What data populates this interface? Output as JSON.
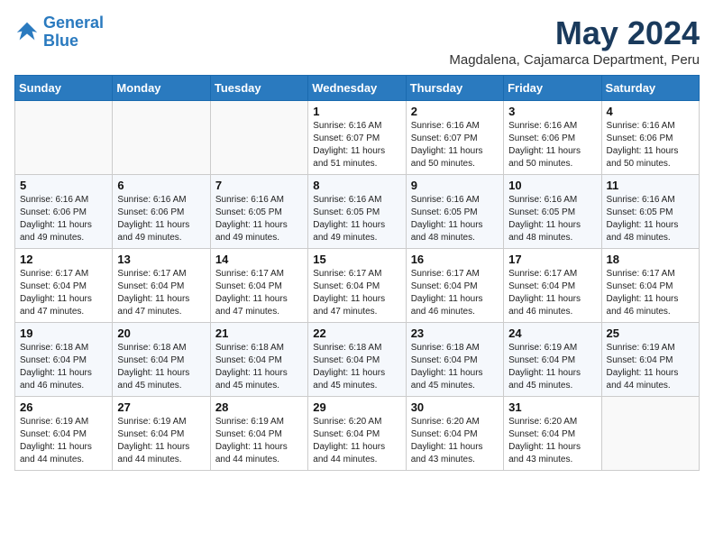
{
  "logo": {
    "line1": "General",
    "line2": "Blue"
  },
  "title": "May 2024",
  "location": "Magdalena, Cajamarca Department, Peru",
  "days_of_week": [
    "Sunday",
    "Monday",
    "Tuesday",
    "Wednesday",
    "Thursday",
    "Friday",
    "Saturday"
  ],
  "weeks": [
    [
      {
        "day": "",
        "info": ""
      },
      {
        "day": "",
        "info": ""
      },
      {
        "day": "",
        "info": ""
      },
      {
        "day": "1",
        "info": "Sunrise: 6:16 AM\nSunset: 6:07 PM\nDaylight: 11 hours\nand 51 minutes."
      },
      {
        "day": "2",
        "info": "Sunrise: 6:16 AM\nSunset: 6:07 PM\nDaylight: 11 hours\nand 50 minutes."
      },
      {
        "day": "3",
        "info": "Sunrise: 6:16 AM\nSunset: 6:06 PM\nDaylight: 11 hours\nand 50 minutes."
      },
      {
        "day": "4",
        "info": "Sunrise: 6:16 AM\nSunset: 6:06 PM\nDaylight: 11 hours\nand 50 minutes."
      }
    ],
    [
      {
        "day": "5",
        "info": "Sunrise: 6:16 AM\nSunset: 6:06 PM\nDaylight: 11 hours\nand 49 minutes."
      },
      {
        "day": "6",
        "info": "Sunrise: 6:16 AM\nSunset: 6:06 PM\nDaylight: 11 hours\nand 49 minutes."
      },
      {
        "day": "7",
        "info": "Sunrise: 6:16 AM\nSunset: 6:05 PM\nDaylight: 11 hours\nand 49 minutes."
      },
      {
        "day": "8",
        "info": "Sunrise: 6:16 AM\nSunset: 6:05 PM\nDaylight: 11 hours\nand 49 minutes."
      },
      {
        "day": "9",
        "info": "Sunrise: 6:16 AM\nSunset: 6:05 PM\nDaylight: 11 hours\nand 48 minutes."
      },
      {
        "day": "10",
        "info": "Sunrise: 6:16 AM\nSunset: 6:05 PM\nDaylight: 11 hours\nand 48 minutes."
      },
      {
        "day": "11",
        "info": "Sunrise: 6:16 AM\nSunset: 6:05 PM\nDaylight: 11 hours\nand 48 minutes."
      }
    ],
    [
      {
        "day": "12",
        "info": "Sunrise: 6:17 AM\nSunset: 6:04 PM\nDaylight: 11 hours\nand 47 minutes."
      },
      {
        "day": "13",
        "info": "Sunrise: 6:17 AM\nSunset: 6:04 PM\nDaylight: 11 hours\nand 47 minutes."
      },
      {
        "day": "14",
        "info": "Sunrise: 6:17 AM\nSunset: 6:04 PM\nDaylight: 11 hours\nand 47 minutes."
      },
      {
        "day": "15",
        "info": "Sunrise: 6:17 AM\nSunset: 6:04 PM\nDaylight: 11 hours\nand 47 minutes."
      },
      {
        "day": "16",
        "info": "Sunrise: 6:17 AM\nSunset: 6:04 PM\nDaylight: 11 hours\nand 46 minutes."
      },
      {
        "day": "17",
        "info": "Sunrise: 6:17 AM\nSunset: 6:04 PM\nDaylight: 11 hours\nand 46 minutes."
      },
      {
        "day": "18",
        "info": "Sunrise: 6:17 AM\nSunset: 6:04 PM\nDaylight: 11 hours\nand 46 minutes."
      }
    ],
    [
      {
        "day": "19",
        "info": "Sunrise: 6:18 AM\nSunset: 6:04 PM\nDaylight: 11 hours\nand 46 minutes."
      },
      {
        "day": "20",
        "info": "Sunrise: 6:18 AM\nSunset: 6:04 PM\nDaylight: 11 hours\nand 45 minutes."
      },
      {
        "day": "21",
        "info": "Sunrise: 6:18 AM\nSunset: 6:04 PM\nDaylight: 11 hours\nand 45 minutes."
      },
      {
        "day": "22",
        "info": "Sunrise: 6:18 AM\nSunset: 6:04 PM\nDaylight: 11 hours\nand 45 minutes."
      },
      {
        "day": "23",
        "info": "Sunrise: 6:18 AM\nSunset: 6:04 PM\nDaylight: 11 hours\nand 45 minutes."
      },
      {
        "day": "24",
        "info": "Sunrise: 6:19 AM\nSunset: 6:04 PM\nDaylight: 11 hours\nand 45 minutes."
      },
      {
        "day": "25",
        "info": "Sunrise: 6:19 AM\nSunset: 6:04 PM\nDaylight: 11 hours\nand 44 minutes."
      }
    ],
    [
      {
        "day": "26",
        "info": "Sunrise: 6:19 AM\nSunset: 6:04 PM\nDaylight: 11 hours\nand 44 minutes."
      },
      {
        "day": "27",
        "info": "Sunrise: 6:19 AM\nSunset: 6:04 PM\nDaylight: 11 hours\nand 44 minutes."
      },
      {
        "day": "28",
        "info": "Sunrise: 6:19 AM\nSunset: 6:04 PM\nDaylight: 11 hours\nand 44 minutes."
      },
      {
        "day": "29",
        "info": "Sunrise: 6:20 AM\nSunset: 6:04 PM\nDaylight: 11 hours\nand 44 minutes."
      },
      {
        "day": "30",
        "info": "Sunrise: 6:20 AM\nSunset: 6:04 PM\nDaylight: 11 hours\nand 43 minutes."
      },
      {
        "day": "31",
        "info": "Sunrise: 6:20 AM\nSunset: 6:04 PM\nDaylight: 11 hours\nand 43 minutes."
      },
      {
        "day": "",
        "info": ""
      }
    ]
  ]
}
